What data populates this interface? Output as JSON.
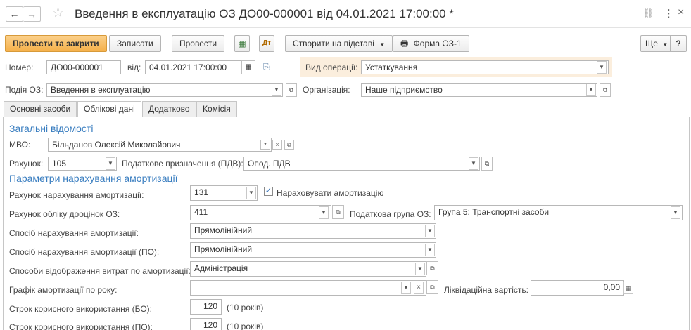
{
  "title": "Введення в експлуатацію ОЗ ДО00-000001 від 04.01.2021 17:00:00 *",
  "header_icons": {
    "link": "⛓",
    "more": "⋮",
    "close": "×"
  },
  "toolbar": {
    "post_close": "Провести та закрити",
    "save": "Записати",
    "post": "Провести",
    "create_based": "Створити на підставі",
    "form_os1": "Форма ОЗ-1",
    "more": "Ще",
    "help": "?"
  },
  "header": {
    "number_label": "Номер:",
    "number_value": "ДО00-000001",
    "date_label": "від:",
    "date_value": "04.01.2021 17:00:00",
    "operation_label": "Вид операції:",
    "operation_value": "Устаткування",
    "event_label": "Подія ОЗ:",
    "event_value": "Введення в експлуатацію",
    "org_label": "Організація:",
    "org_value": "Наше підприємство"
  },
  "tabs": [
    "Основні засоби",
    "Облікові дані",
    "Додатково",
    "Комісія"
  ],
  "active_tab": 1,
  "general": {
    "title": "Загальні відомості",
    "mvo_label": "МВО:",
    "mvo_value": "Більданов Олексій Миколайович",
    "account_label": "Рахунок:",
    "account_value": "105",
    "tax_purpose_label": "Податкове призначення (ПДВ):",
    "tax_purpose_value": "Опод. ПДВ"
  },
  "depreciation": {
    "title": "Параметри нарахування амортизації",
    "dep_account_label": "Рахунок нарахування амортизації:",
    "dep_account_value": "131",
    "accrue_label": "Нараховувати амортизацію",
    "accrue_checked": "✓",
    "reval_account_label": "Рахунок обліку дооцінок ОЗ:",
    "reval_account_value": "411",
    "tax_group_label": "Податкова група ОЗ:",
    "tax_group_value": "Група 5: Транспортні засоби",
    "method_label": "Спосіб нарахування амортизації:",
    "method_value": "Прямолінійний",
    "method_po_label": "Спосіб нарахування амортизації (ПО):",
    "method_po_value": "Прямолінійний",
    "expense_label": "Способи відображення витрат по амортизації:",
    "expense_value": "Адміністрація",
    "schedule_label": "Графік амортизації по року:",
    "schedule_value": "",
    "liquidation_label": "Ліквідаційна вартість:",
    "liquidation_value": "0,00",
    "life_bo_label": "Строк корисного використання (БО):",
    "life_bo_value": "120",
    "life_bo_note": "(10 років)",
    "life_po_label": "Строк корисного використання (ПО):",
    "life_po_value": "120",
    "life_po_note": "(10 років)"
  }
}
